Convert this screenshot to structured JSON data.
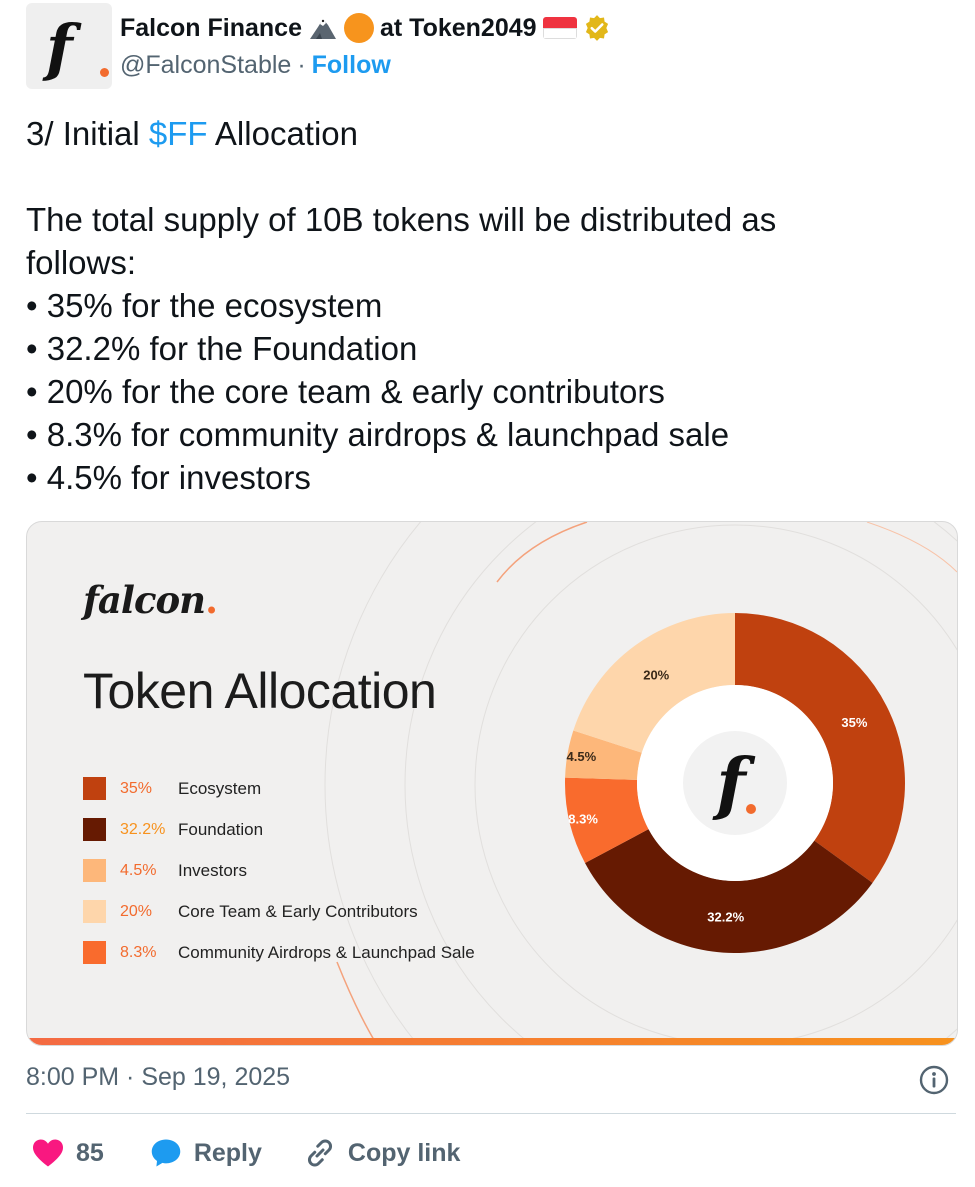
{
  "author": {
    "name": "Falcon Finance",
    "name_suffix": "at Token2049",
    "handle": "@FalconStable",
    "separator": "·",
    "follow_label": "Follow"
  },
  "tweet": {
    "title_prefix": "3/ Initial ",
    "ticker": "$FF",
    "title_suffix": " Allocation",
    "intro": "The total supply of 10B tokens will be distributed as follows:",
    "bullets": [
      "• 35% for the ecosystem",
      "• 32.2% for the Foundation",
      "• 20% for the core team & early contributors",
      "• 8.3% for community airdrops & launchpad sale",
      "• 4.5% for investors"
    ]
  },
  "card": {
    "logo_text": "falcon",
    "logo_dot": ".",
    "title": "Token Allocation",
    "center_logo_letter": "f",
    "chart_data": {
      "type": "pie",
      "title": "Token Allocation",
      "donut": true,
      "legend_position": "left",
      "slices": [
        {
          "label": "Ecosystem",
          "value": 35,
          "value_label": "35%",
          "color": "#c0410f",
          "pct_color": "#f26b2e"
        },
        {
          "label": "Foundation",
          "value": 32.2,
          "value_label": "32.2%",
          "color": "#661a02",
          "pct_color": "#f7921e"
        },
        {
          "label": "Investors",
          "value": 4.5,
          "value_label": "4.5%",
          "color": "#fdb77a",
          "pct_color": "#f26b2e"
        },
        {
          "label": "Core Team & Early Contributors",
          "value": 20,
          "value_label": "20%",
          "color": "#fed6ab",
          "pct_color": "#f26b2e"
        },
        {
          "label": "Community Airdrops & Launchpad Sale",
          "value": 8.3,
          "value_label": "8.3%",
          "color": "#f96b2d",
          "pct_color": "#f26b2e"
        }
      ],
      "chart_order": [
        "Ecosystem",
        "Foundation",
        "Community Airdrops & Launchpad Sale",
        "Investors",
        "Core Team & Early Contributors"
      ]
    }
  },
  "meta": {
    "timestamp": "8:00 PM · Sep 19, 2025"
  },
  "actions": {
    "likes_count": "85",
    "reply_label": "Reply",
    "copy_link_label": "Copy link"
  },
  "colors": {
    "accent": "#1d9bf0",
    "like": "#f91880",
    "muted": "#536471"
  }
}
